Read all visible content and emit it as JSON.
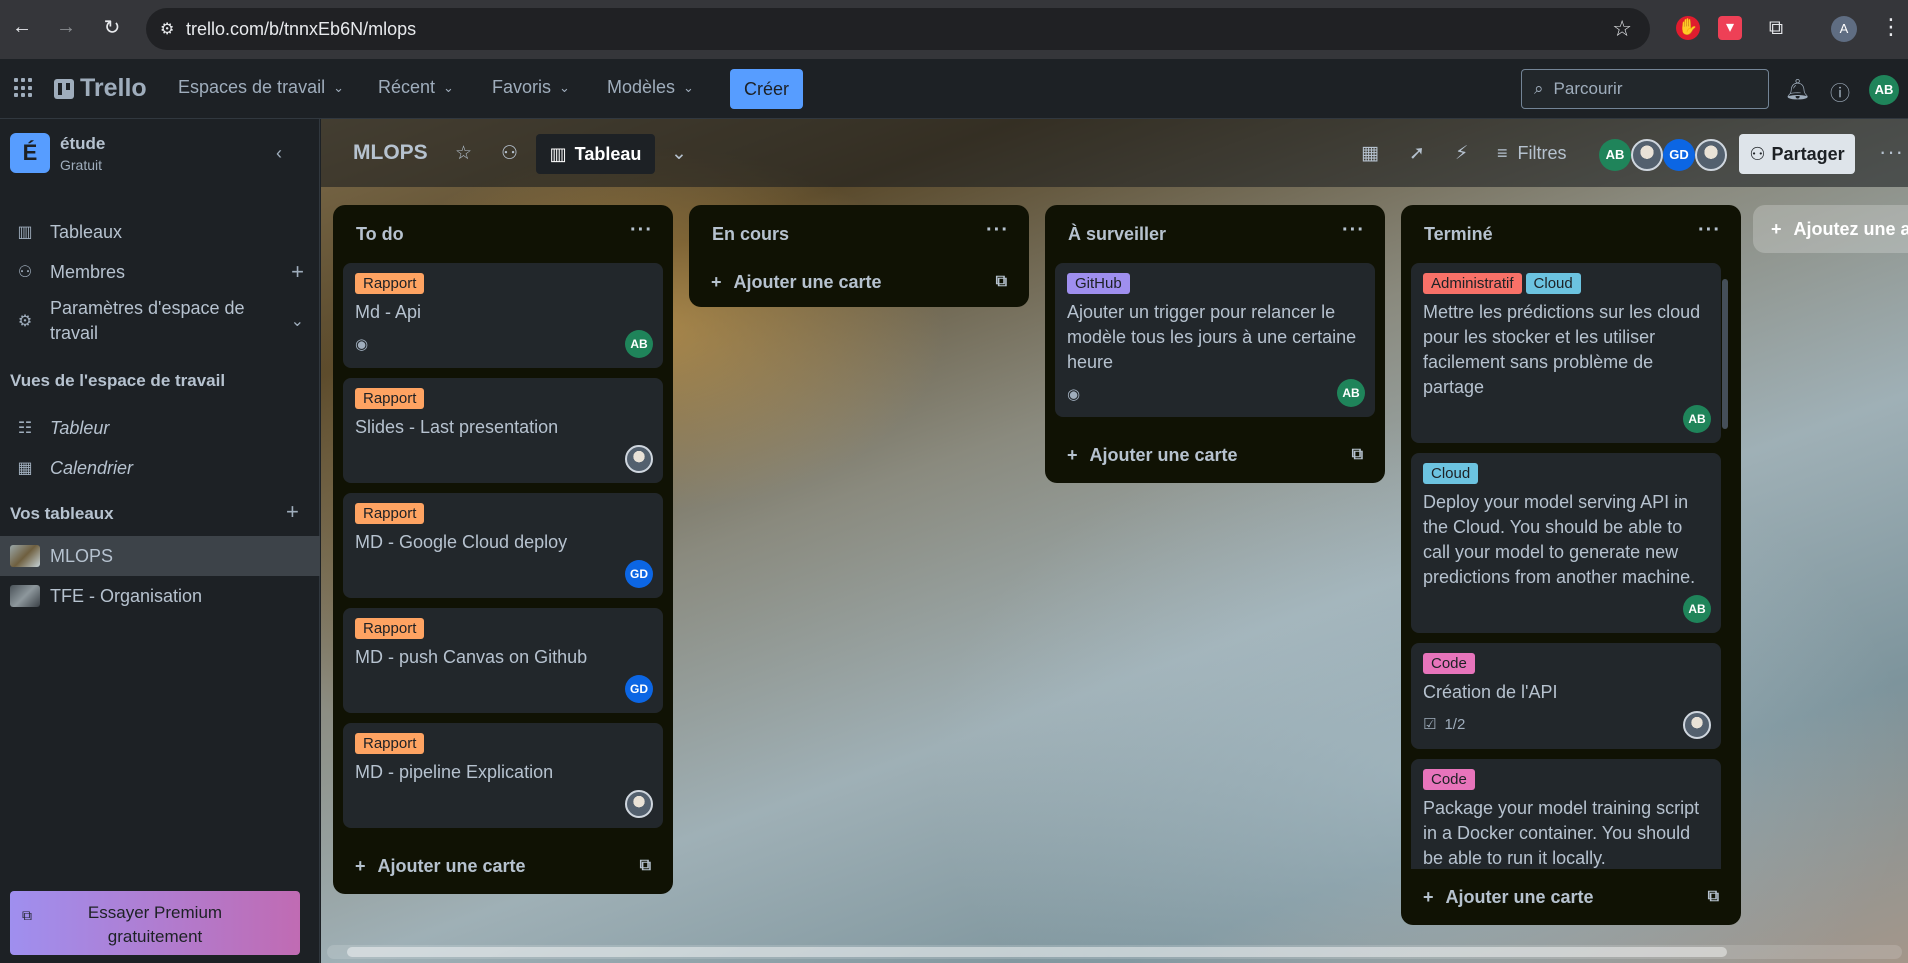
{
  "browser": {
    "url": "trello.com/b/tnnxEb6N/mlops",
    "profile_initial": "A"
  },
  "header": {
    "app_name": "Trello",
    "menus": [
      "Espaces de travail",
      "Récent",
      "Favoris",
      "Modèles"
    ],
    "create_label": "Créer",
    "search_placeholder": "Parcourir",
    "user_initials": "AB"
  },
  "sidebar": {
    "workspace_initial": "É",
    "workspace_name": "étude",
    "workspace_plan": "Gratuit",
    "items": [
      {
        "label": "Tableaux",
        "icon": "trello-board-icon"
      },
      {
        "label": "Membres",
        "icon": "person-icon"
      },
      {
        "label": "Paramètres d'espace de travail",
        "icon": "gear-icon"
      }
    ],
    "views_title": "Vues de l'espace de travail",
    "views": [
      {
        "label": "Tableur",
        "icon": "table-icon"
      },
      {
        "label": "Calendrier",
        "icon": "calendar-icon"
      }
    ],
    "boards_title": "Vos tableaux",
    "boards": [
      {
        "label": "MLOPS",
        "active": true
      },
      {
        "label": "TFE - Organisation",
        "active": false
      }
    ],
    "premium_label": "Essayer Premium gratuitement"
  },
  "board": {
    "title": "MLOPS",
    "view_label": "Tableau",
    "filter_label": "Filtres",
    "share_label": "Partager",
    "members": [
      "AB",
      "",
      "GD",
      ""
    ],
    "add_list_label": "Ajoutez une autre liste",
    "add_card_label": "Ajouter une carte",
    "lists": [
      {
        "title": "To do",
        "cards": [
          {
            "labels": [
              {
                "text": "Rapport",
                "color": "orange"
              }
            ],
            "title": "Md - Api",
            "watch": true,
            "member": "AB"
          },
          {
            "labels": [
              {
                "text": "Rapport",
                "color": "orange"
              }
            ],
            "title": "Slides - Last presentation",
            "member": "photo"
          },
          {
            "labels": [
              {
                "text": "Rapport",
                "color": "orange"
              }
            ],
            "title": "MD - Google Cloud deploy",
            "member": "GD"
          },
          {
            "labels": [
              {
                "text": "Rapport",
                "color": "orange"
              }
            ],
            "title": "MD - push Canvas on Github",
            "member": "GD"
          },
          {
            "labels": [
              {
                "text": "Rapport",
                "color": "orange"
              }
            ],
            "title": "MD - pipeline Explication",
            "member": "photo"
          }
        ]
      },
      {
        "title": "En cours",
        "cards": []
      },
      {
        "title": "À surveiller",
        "cards": [
          {
            "labels": [
              {
                "text": "GitHub",
                "color": "purple"
              }
            ],
            "title": "Ajouter un trigger pour relancer le modèle tous les jours à une certaine heure",
            "watch": true,
            "member": "AB"
          }
        ]
      },
      {
        "title": "Terminé",
        "cards": [
          {
            "labels": [
              {
                "text": "Administratif",
                "color": "red"
              },
              {
                "text": "Cloud",
                "color": "sky"
              }
            ],
            "title": "Mettre les prédictions sur les cloud pour les stocker et les utiliser facilement sans problème de partage",
            "member": "AB"
          },
          {
            "labels": [
              {
                "text": "Cloud",
                "color": "sky"
              }
            ],
            "title": "Deploy your model serving API in the Cloud. You should be able to call your model to generate new predictions from another machine.",
            "member": "AB"
          },
          {
            "labels": [
              {
                "text": "Code",
                "color": "pink"
              }
            ],
            "title": "Création de l'API",
            "checklist": "1/2",
            "member": "photo"
          },
          {
            "labels": [
              {
                "text": "Code",
                "color": "pink"
              }
            ],
            "title": "Package your model training script in a Docker container. You should be able to run it locally."
          }
        ]
      }
    ]
  },
  "colors": {
    "orange": "#fea362",
    "purple": "#9f8fef",
    "red": "#f87168",
    "sky": "#6cc3e0",
    "pink": "#e774bb",
    "accent": "#579dff"
  }
}
